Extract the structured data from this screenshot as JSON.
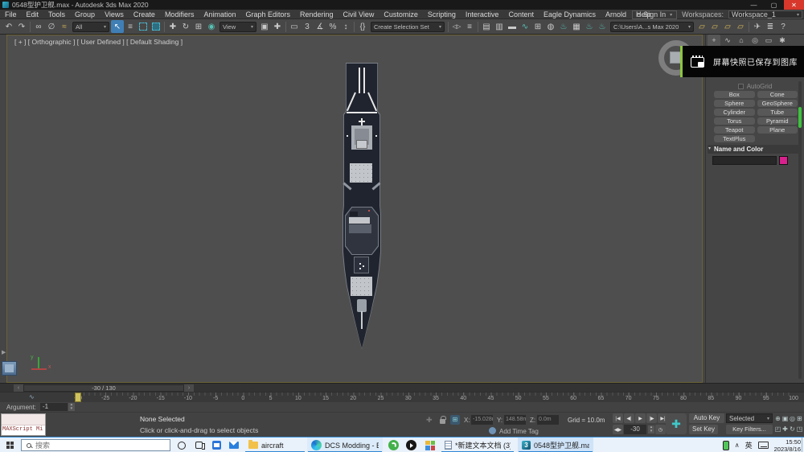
{
  "window": {
    "title": "0548型护卫舰.max - Autodesk 3ds Max 2020"
  },
  "menubar": {
    "items": [
      "File",
      "Edit",
      "Tools",
      "Group",
      "Views",
      "Create",
      "Modifiers",
      "Animation",
      "Graph Editors",
      "Rendering",
      "Civil View",
      "Customize",
      "Scripting",
      "Interactive",
      "Content",
      "Eagle Dynamics",
      "Arnold",
      "Help"
    ],
    "sign_in": "Sign In",
    "workspaces_label": "Workspaces:",
    "workspace": "Workspace_1"
  },
  "toolbar": {
    "selection_filter": "All",
    "ref_coord": "View",
    "create_selection_set": "Create Selection Set",
    "project_path": "C:\\Users\\A...s Max 2020",
    "snap_value": "3",
    "help": "?"
  },
  "viewport": {
    "label": "[ + ] [ Orthographic ] [ User Defined ] [ Default Shading ]"
  },
  "notification": {
    "message": "屏幕快照已保存到图库",
    "accent": "#8dc63f"
  },
  "command_panel": {
    "autogrid": "AutoGrid",
    "object_buttons": [
      "Box",
      "Cone",
      "Sphere",
      "GeoSphere",
      "Cylinder",
      "Tube",
      "Torus",
      "Pyramid",
      "Teapot",
      "Plane",
      "TextPlus"
    ],
    "name_color_header": "Name and Color",
    "name_value": "",
    "swatch_color": "#d8218c"
  },
  "trackbar": {
    "display": "-30 / 130"
  },
  "timeline": {
    "start": -30,
    "end": 100,
    "step": 5,
    "current": -30
  },
  "statusbar": {
    "argument_label": "Argument:",
    "argument_value": "-1",
    "maxscript": "MAXScript Mi",
    "status": "None Selected",
    "prompt": "Click or click-and-drag to select objects",
    "coords": {
      "x_label": "X:",
      "x": "-15.028m",
      "y_label": "Y:",
      "y": "148.58m",
      "z_label": "Z:",
      "z": "0.0m"
    },
    "grid": "Grid = 10.0m",
    "add_time_tag": "Add Time Tag",
    "frame": "-30",
    "auto_key": "Auto Key",
    "set_key": "Set Key",
    "selected": "Selected",
    "key_filters": "Key Filters..."
  },
  "taskbar": {
    "search_placeholder": "搜索",
    "apps": [
      {
        "label": "aircraft"
      },
      {
        "label": "DCS Modding - E..."
      },
      {
        "label": "*新建文本文档 (3).t..."
      },
      {
        "label": "0548型护卫舰.ma..."
      }
    ],
    "tray": {
      "ime": "英",
      "time": "15:50",
      "date": "2023/8/16"
    }
  },
  "icons": {
    "dd": "▾",
    "undo": "↶",
    "redo": "↷",
    "link": "∞",
    "unlink": "∅",
    "bind": "≈",
    "selobj": "↖",
    "selname": "≡",
    "move": "✚",
    "rotate": "↻",
    "scale": "⊞",
    "place": "◉",
    "pivot": "▣",
    "manip": "✚",
    "kbd": "▭",
    "snap": "3",
    "asnap": "∡",
    "psnap": "%",
    "ssnap": "↕",
    "nsets": "{}",
    "mirror": "◁▷",
    "align": "≡",
    "sexp": "▤",
    "lexp": "▥",
    "ribbon": "▬",
    "curve": "∿",
    "schem": "⊞",
    "mat": "◍",
    "rset": "♨",
    "rfw": "▦",
    "rprod": "♨",
    "riter": "♨",
    "folder": "▱",
    "plane": "✈",
    "script": "≣",
    "help": "?",
    "tcreate": "+",
    "tmod": "∿",
    "thier": "⌂",
    "tmotion": "◎",
    "tdisp": "▭",
    "tutil": "✱",
    "pstart": "|◀",
    "pprev": "◀|",
    "pplay": "▶",
    "pnext": "|▶",
    "pend": "▶|",
    "keymode": "◀▶",
    "tcfg": "◷",
    "nzoom": "⊕",
    "nzoomall": "▣",
    "nextents": "◎",
    "nextentsall": "⊞",
    "nregion": "◰",
    "npan": "✚",
    "norbit": "↻",
    "nmax": "◳",
    "up": "▴",
    "down": "▾",
    "left": "‹",
    "right": "›",
    "wave": "∿",
    "clockglyph": "◷"
  }
}
